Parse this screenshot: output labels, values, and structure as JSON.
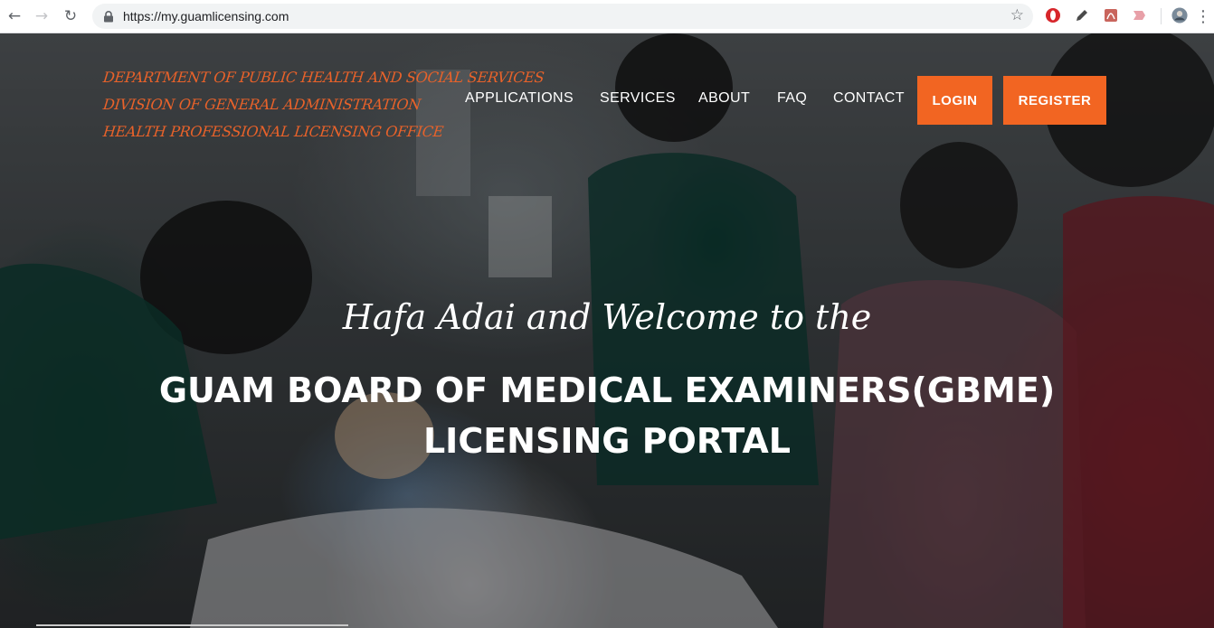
{
  "browser": {
    "url": "https://my.guamlicensing.com",
    "back_icon": "←",
    "forward_icon": "→",
    "reload_icon": "↻",
    "star_icon": "☆",
    "menu_icon": "⋮"
  },
  "header": {
    "dept_lines": [
      "DEPARTMENT OF PUBLIC HEALTH AND SOCIAL SERVICES",
      "DIVISION OF GENERAL ADMINISTRATION",
      "HEALTH PROFESSIONAL LICENSING OFFICE"
    ],
    "nav": [
      "APPLICATIONS",
      "SERVICES",
      "ABOUT",
      "FAQ",
      "CONTACT"
    ],
    "login_label": "LOGIN",
    "register_label": "REGISTER"
  },
  "hero": {
    "welcome": "Hafa Adai and Welcome to the",
    "title_line1": "GUAM BOARD OF MEDICAL EXAMINERS(GBME)",
    "title_line2": "LICENSING PORTAL"
  },
  "colors": {
    "accent": "#f26522",
    "dept_text": "#e8622a"
  }
}
